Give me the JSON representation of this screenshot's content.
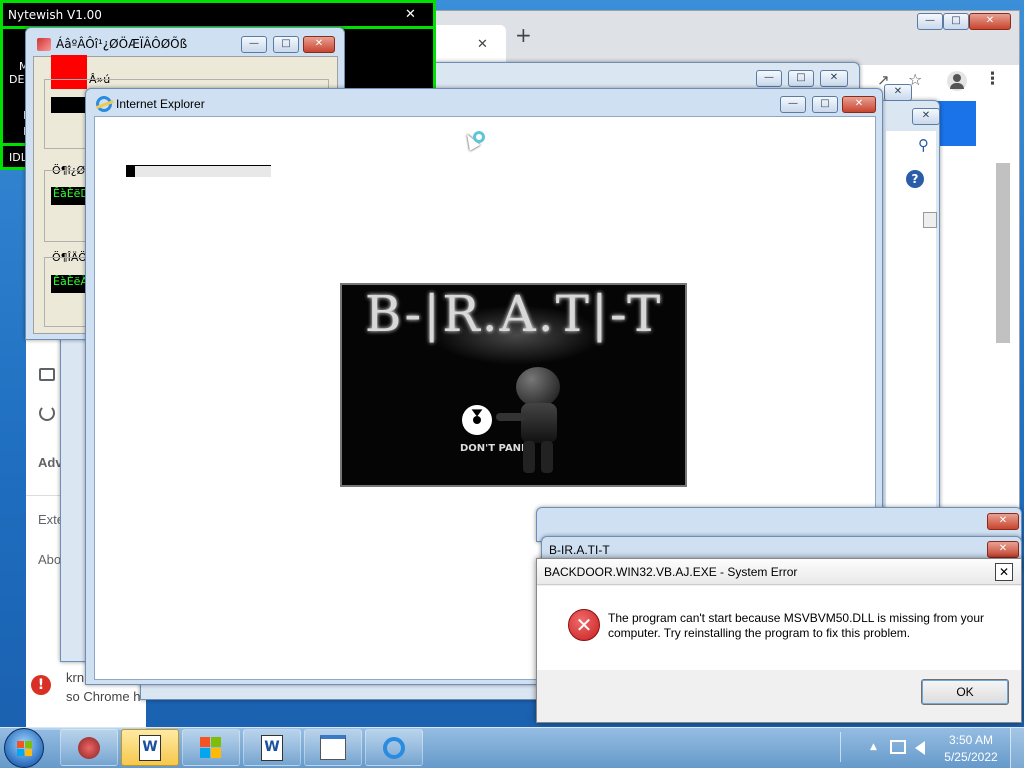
{
  "nytewish": {
    "title": "Nytewish V1.00",
    "close_glyph": "✕",
    "side_text": [
      "M",
      "DE",
      "I",
      "I",
      "IDL"
    ]
  },
  "chrome_window": {
    "new_tab_glyph": "+",
    "tab_close_glyph": "✕",
    "min_glyph": "—",
    "max_glyph": "□",
    "close_glyph": "✕",
    "menu_glyph": "⋮",
    "star_glyph": "☆",
    "share_glyph": "↗",
    "search_glyph": "⚲",
    "help_glyph": "?",
    "sidebar_labels": [
      "Adv",
      "Exte",
      "Abo"
    ],
    "notice_line1": "krn",
    "notice_line2": "so Chrome h"
  },
  "garbled_window": {
    "title": "ÁâºÂÔî¹¿ØÖÆÏÂÔØÕß",
    "label1": "Â»ú",
    "label2": "Ö¶î¿Ø",
    "value2": "ÊàÈëD",
    "label3": "Ö¶ÎÄÖ",
    "value3": "ÊàÈëÄ"
  },
  "ie_window": {
    "title": "Internet Explorer",
    "progress_pct": 6
  },
  "brat_banner": {
    "title": "B-|R.A.T|-T",
    "caption": "DON'T PANIC"
  },
  "brat_dialog": {
    "title": "B-IR.A.TI-T"
  },
  "error_dialog": {
    "title": "BACKDOOR.WIN32.VB.AJ.EXE - System Error",
    "message_line1": "The program can't start because MSVBVM50.DLL is missing from your",
    "message_line2": "computer. Try reinstalling the program to fix this problem.",
    "ok_label": "OK",
    "close_glyph": "✕"
  },
  "taskbar": {
    "clock_time": "3:50 AM",
    "clock_date": "5/25/2022",
    "buttons": [
      "start",
      "program",
      "word",
      "windows",
      "word2",
      "notepad",
      "ie"
    ]
  },
  "colors": {
    "nytewish_border": "#00e000",
    "error_icon": "#d22b2b",
    "red_square": "#ff0000"
  }
}
